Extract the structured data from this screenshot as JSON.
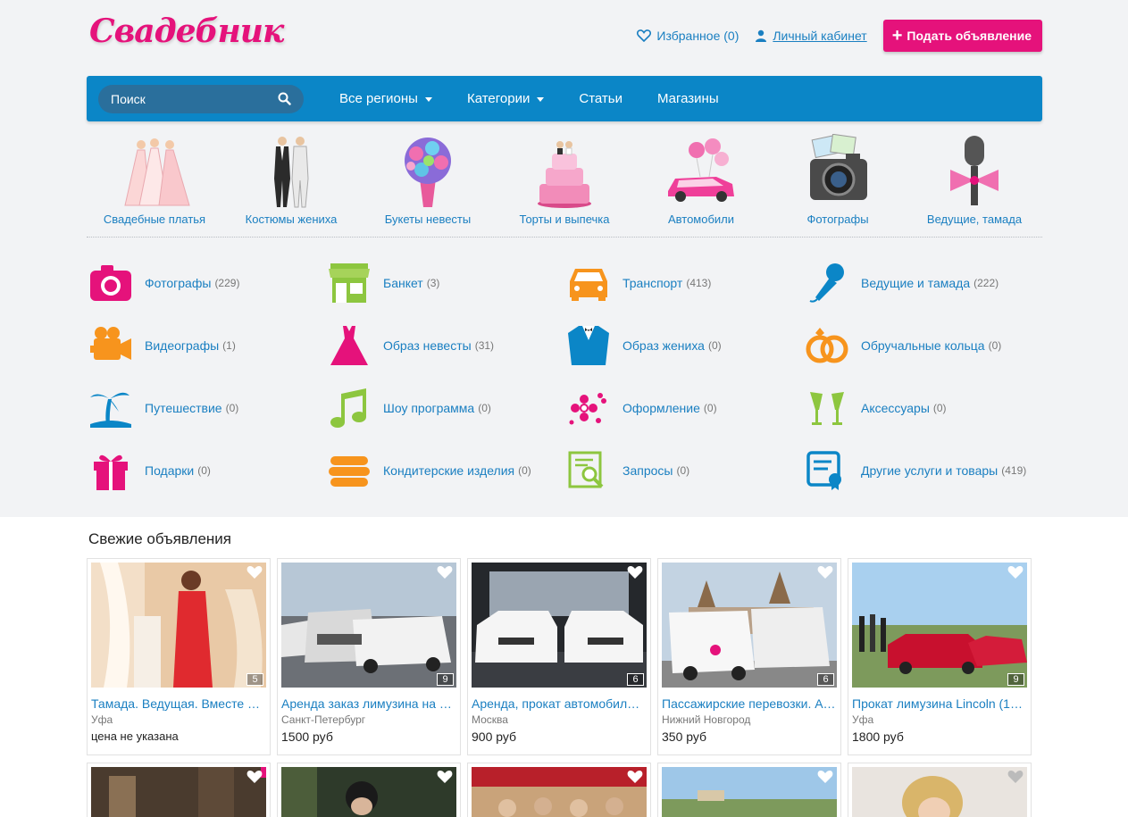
{
  "header": {
    "logo": "Свадебник",
    "favorites": "Избранное (0)",
    "cabinet": "Личный кабинет",
    "post_button": "Подать объявление"
  },
  "nav": {
    "search_placeholder": "Поиск",
    "items": [
      "Все регионы",
      "Категории",
      "Статьи",
      "Магазины"
    ]
  },
  "featured": [
    {
      "label": "Свадебные платья",
      "icon": "wedding-dresses-icon"
    },
    {
      "label": "Костюмы жениха",
      "icon": "groom-suits-icon"
    },
    {
      "label": "Букеты невесты",
      "icon": "bouquet-icon"
    },
    {
      "label": "Торты и выпечка",
      "icon": "cake-icon"
    },
    {
      "label": "Автомобили",
      "icon": "car-icon"
    },
    {
      "label": "Фотографы",
      "icon": "camera-icon"
    },
    {
      "label": "Ведущие, тамада",
      "icon": "microphone-icon"
    }
  ],
  "categories": [
    {
      "name": "Фотографы",
      "count": "(229)",
      "icon": "camera-icon",
      "color": "#e5127b"
    },
    {
      "name": "Банкет",
      "count": "(3)",
      "icon": "shop-icon",
      "color": "#8dc63f"
    },
    {
      "name": "Транспорт",
      "count": "(413)",
      "icon": "car-icon",
      "color": "#f7941d"
    },
    {
      "name": "Ведущие и тамада",
      "count": "(222)",
      "icon": "microphone-icon",
      "color": "#0b86c7"
    },
    {
      "name": "Видеографы",
      "count": "(1)",
      "icon": "video-camera-icon",
      "color": "#f7941d"
    },
    {
      "name": "Образ невесты",
      "count": "(31)",
      "icon": "dress-icon",
      "color": "#e5127b"
    },
    {
      "name": "Образ жениха",
      "count": "(0)",
      "icon": "suit-icon",
      "color": "#0b86c7"
    },
    {
      "name": "Обручальные кольца",
      "count": "(0)",
      "icon": "rings-icon",
      "color": "#f7941d"
    },
    {
      "name": "Путешествие",
      "count": "(0)",
      "icon": "palm-icon",
      "color": "#0b86c7"
    },
    {
      "name": "Шоу программа",
      "count": "(0)",
      "icon": "music-note-icon",
      "color": "#8dc63f"
    },
    {
      "name": "Оформление",
      "count": "(0)",
      "icon": "flowers-icon",
      "color": "#e5127b"
    },
    {
      "name": "Аксессуары",
      "count": "(0)",
      "icon": "champagne-icon",
      "color": "#8dc63f"
    },
    {
      "name": "Подарки",
      "count": "(0)",
      "icon": "gift-icon",
      "color": "#e5127b"
    },
    {
      "name": "Кондитерские изделия",
      "count": "(0)",
      "icon": "cake-layers-icon",
      "color": "#f7941d"
    },
    {
      "name": "Запросы",
      "count": "(0)",
      "icon": "search-doc-icon",
      "color": "#8dc63f"
    },
    {
      "name": "Другие услуги и товары",
      "count": "(419)",
      "icon": "certificate-icon",
      "color": "#0b86c7"
    }
  ],
  "fresh": {
    "title": "Свежие объявления",
    "cards": [
      {
        "title": "Тамада. Ведущая. Вместе …",
        "city": "Уфа",
        "price": "цена не указана",
        "photos": "5"
      },
      {
        "title": "Аренда заказ лимузина на …",
        "city": "Санкт-Петербург",
        "price": "1500 руб",
        "photos": "9"
      },
      {
        "title": "Аренда, прокат автомобил…",
        "city": "Москва",
        "price": "900 руб",
        "photos": "6"
      },
      {
        "title": "Пассажирские перевозки. А…",
        "city": "Нижний Новгород",
        "price": "350 руб",
        "photos": "6"
      },
      {
        "title": "Прокат лимузина Lincoln (1…",
        "city": "Уфа",
        "price": "1800 руб",
        "photos": "9"
      }
    ]
  }
}
